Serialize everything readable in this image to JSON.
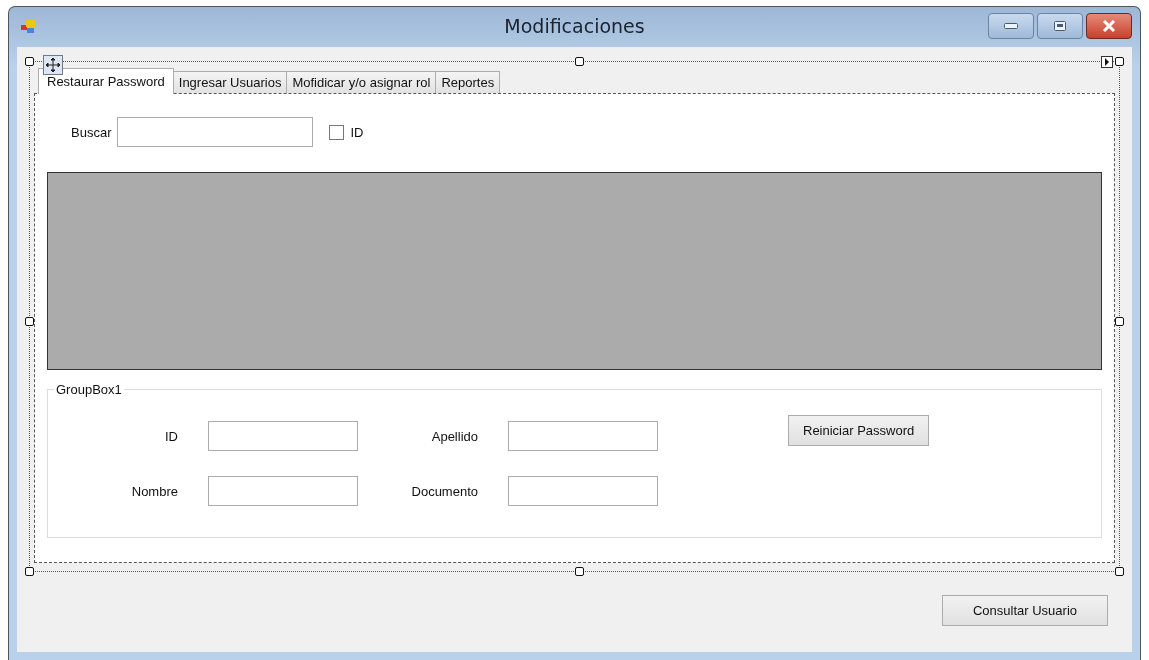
{
  "window": {
    "title": "Modificaciones"
  },
  "tabs": [
    {
      "label": "Restaurar Password",
      "selected": true
    },
    {
      "label": "Ingresar Usuarios",
      "selected": false
    },
    {
      "label": "Mofidicar y/o asignar rol",
      "selected": false
    },
    {
      "label": "Reportes",
      "selected": false
    }
  ],
  "search": {
    "label": "Buscar",
    "checkbox": {
      "label": "ID",
      "checked": false
    }
  },
  "group_box": {
    "title": "GroupBox1",
    "fields": [
      {
        "label": "ID"
      },
      {
        "label": "Apellido"
      },
      {
        "label": "Nombre"
      },
      {
        "label": "Documento"
      }
    ],
    "button": "Reiniciar Password"
  },
  "buttons": [
    "Consultar Usuario"
  ]
}
